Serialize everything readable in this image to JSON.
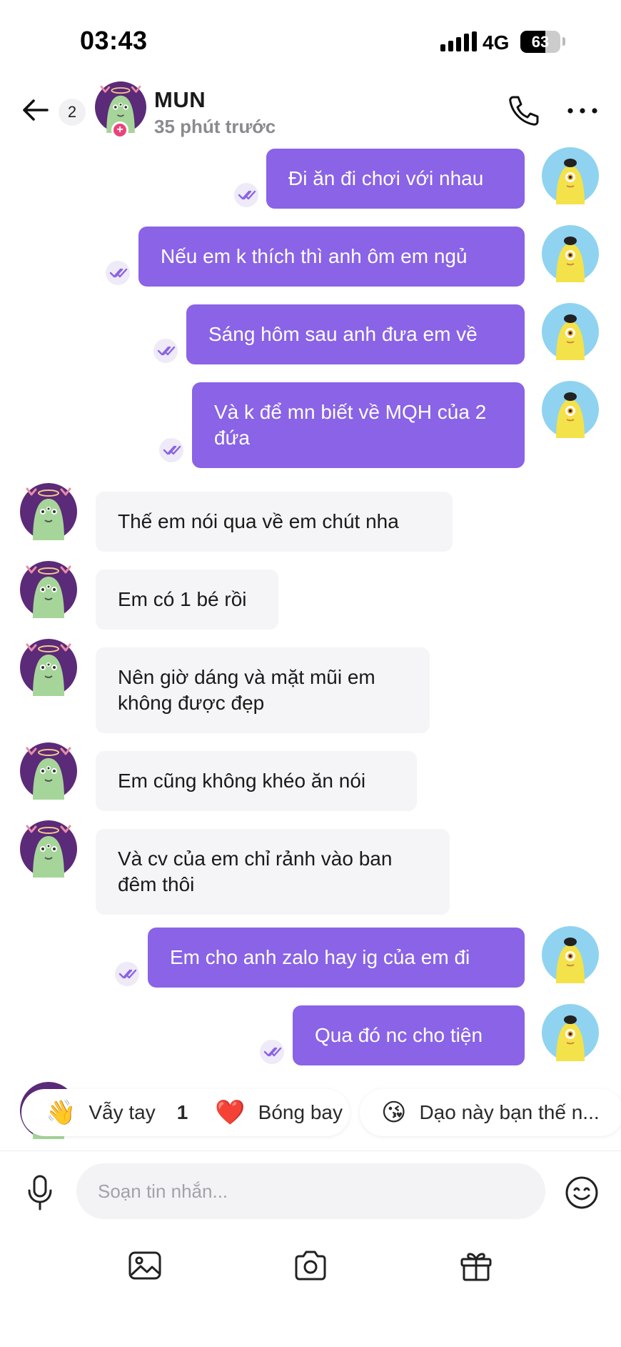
{
  "status_bar": {
    "time": "03:43",
    "network": "4G",
    "battery": "63"
  },
  "header": {
    "back_icon": "arrow-left-icon",
    "unread_count": "2",
    "name": "MUN",
    "last_seen": "35 phút trước",
    "call_icon": "phone-icon",
    "more_icon": "more-horizontal-icon"
  },
  "messages": [
    {
      "direction": "out",
      "text": "Đi ăn đi chơi với nhau"
    },
    {
      "direction": "out",
      "text": "Nếu em k thích thì anh ôm em ngủ"
    },
    {
      "direction": "out",
      "text": "Sáng hôm sau anh đưa em về"
    },
    {
      "direction": "out",
      "text": "Và k để mn biết về MQH của 2 đứa"
    },
    {
      "direction": "in",
      "text": "Thế em nói qua về em chút nha"
    },
    {
      "direction": "in",
      "text": "Em có 1 bé rồi"
    },
    {
      "direction": "in",
      "text": "Nên giờ dáng và mặt mũi em không được đẹp"
    },
    {
      "direction": "in",
      "text": "Em cũng không khéo ăn nói"
    },
    {
      "direction": "in",
      "text": "Và cv của em chỉ rảnh vào ban đêm thôi"
    },
    {
      "direction": "out",
      "text": "Em cho anh zalo hay ig của em đi"
    },
    {
      "direction": "out",
      "text": "Qua đó nc cho tiện"
    }
  ],
  "quick_replies": [
    {
      "emoji": "👋",
      "label": "Vẫy tay",
      "count": "1"
    },
    {
      "emoji": "❤️",
      "label": "Bóng bay"
    },
    {
      "emoji": "😘",
      "label": "Dạo này bạn thế n..."
    }
  ],
  "composer": {
    "placeholder": "Soạn tin nhắn...",
    "mic_icon": "microphone-icon",
    "emoji_icon": "smiley-icon"
  },
  "toolbar": {
    "image_icon": "image-icon",
    "camera_icon": "camera-icon",
    "gift_icon": "gift-icon"
  },
  "colors": {
    "outgoing_bubble": "#8a63e6",
    "incoming_bubble": "#f5f5f7",
    "seen_check": "#8a63e6"
  }
}
